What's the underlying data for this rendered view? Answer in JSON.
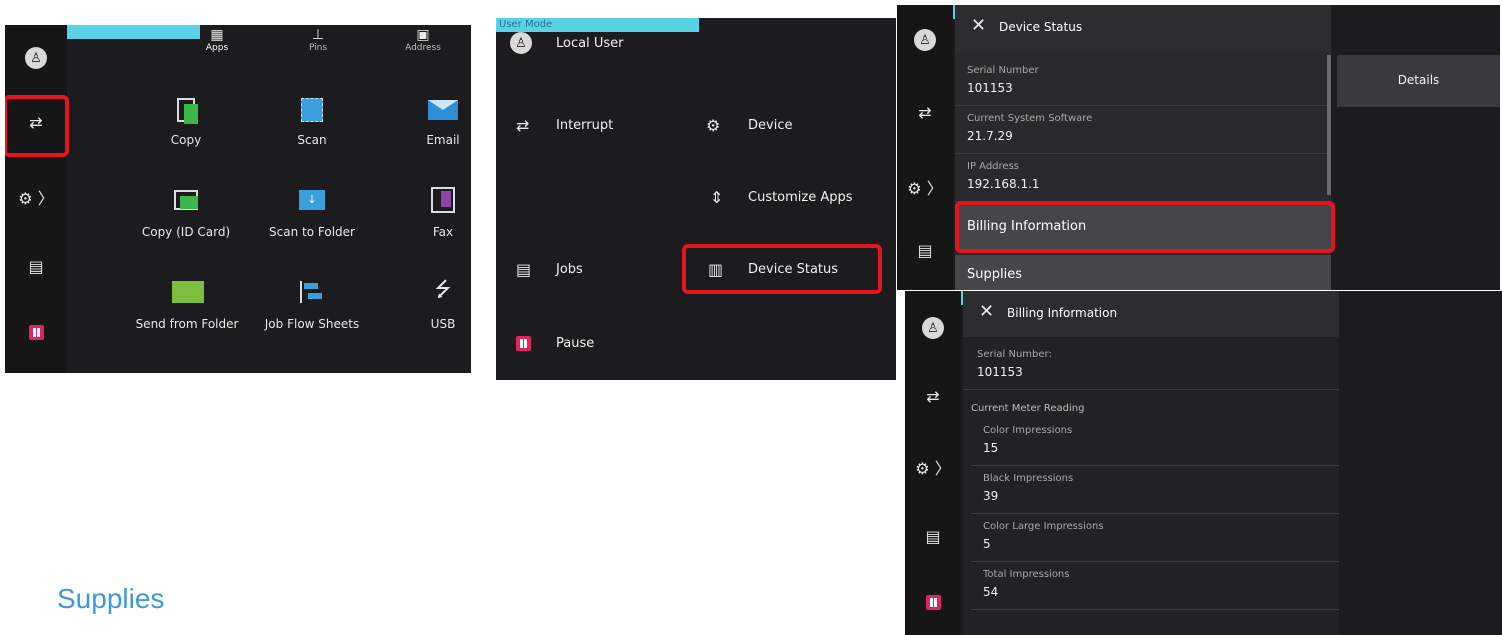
{
  "user_mode": "User Mode",
  "s1": {
    "tabs": [
      "Apps",
      "Pins",
      "Address"
    ],
    "apps": [
      "Copy",
      "Scan",
      "Email",
      "Copy (ID Card)",
      "Scan to Folder",
      "Fax",
      "Send from Folder",
      "Job Flow Sheets",
      "USB"
    ]
  },
  "s2": {
    "local_user": "Local User",
    "interrupt": "Interrupt",
    "device": "Device",
    "customize_apps": "Customize Apps",
    "jobs": "Jobs",
    "device_status": "Device Status",
    "pause": "Pause"
  },
  "s3": {
    "title": "Device Status",
    "details": "Details",
    "rows": [
      {
        "key": "Serial Number",
        "value": "101153"
      },
      {
        "key": "Current System Software",
        "value": "21.7.29"
      },
      {
        "key": "IP Address",
        "value": "192.168.1.1"
      }
    ],
    "billing": "Billing Information",
    "supplies": "Supplies"
  },
  "s4": {
    "title": "Billing Information",
    "serial_key": "Serial Number:",
    "serial_value": "101153",
    "meter_heading": "Current Meter Reading",
    "meters": [
      {
        "key": "Color Impressions",
        "value": "15"
      },
      {
        "key": "Black Impressions",
        "value": "39"
      },
      {
        "key": "Color Large Impressions",
        "value": "5"
      },
      {
        "key": "Total Impressions",
        "value": "54"
      }
    ]
  },
  "caption": "Supplies",
  "colors": {
    "accent": "#5ad2e6",
    "highlight": "#e6141e",
    "pause": "#e0245e",
    "caption": "#3c9ad6"
  }
}
